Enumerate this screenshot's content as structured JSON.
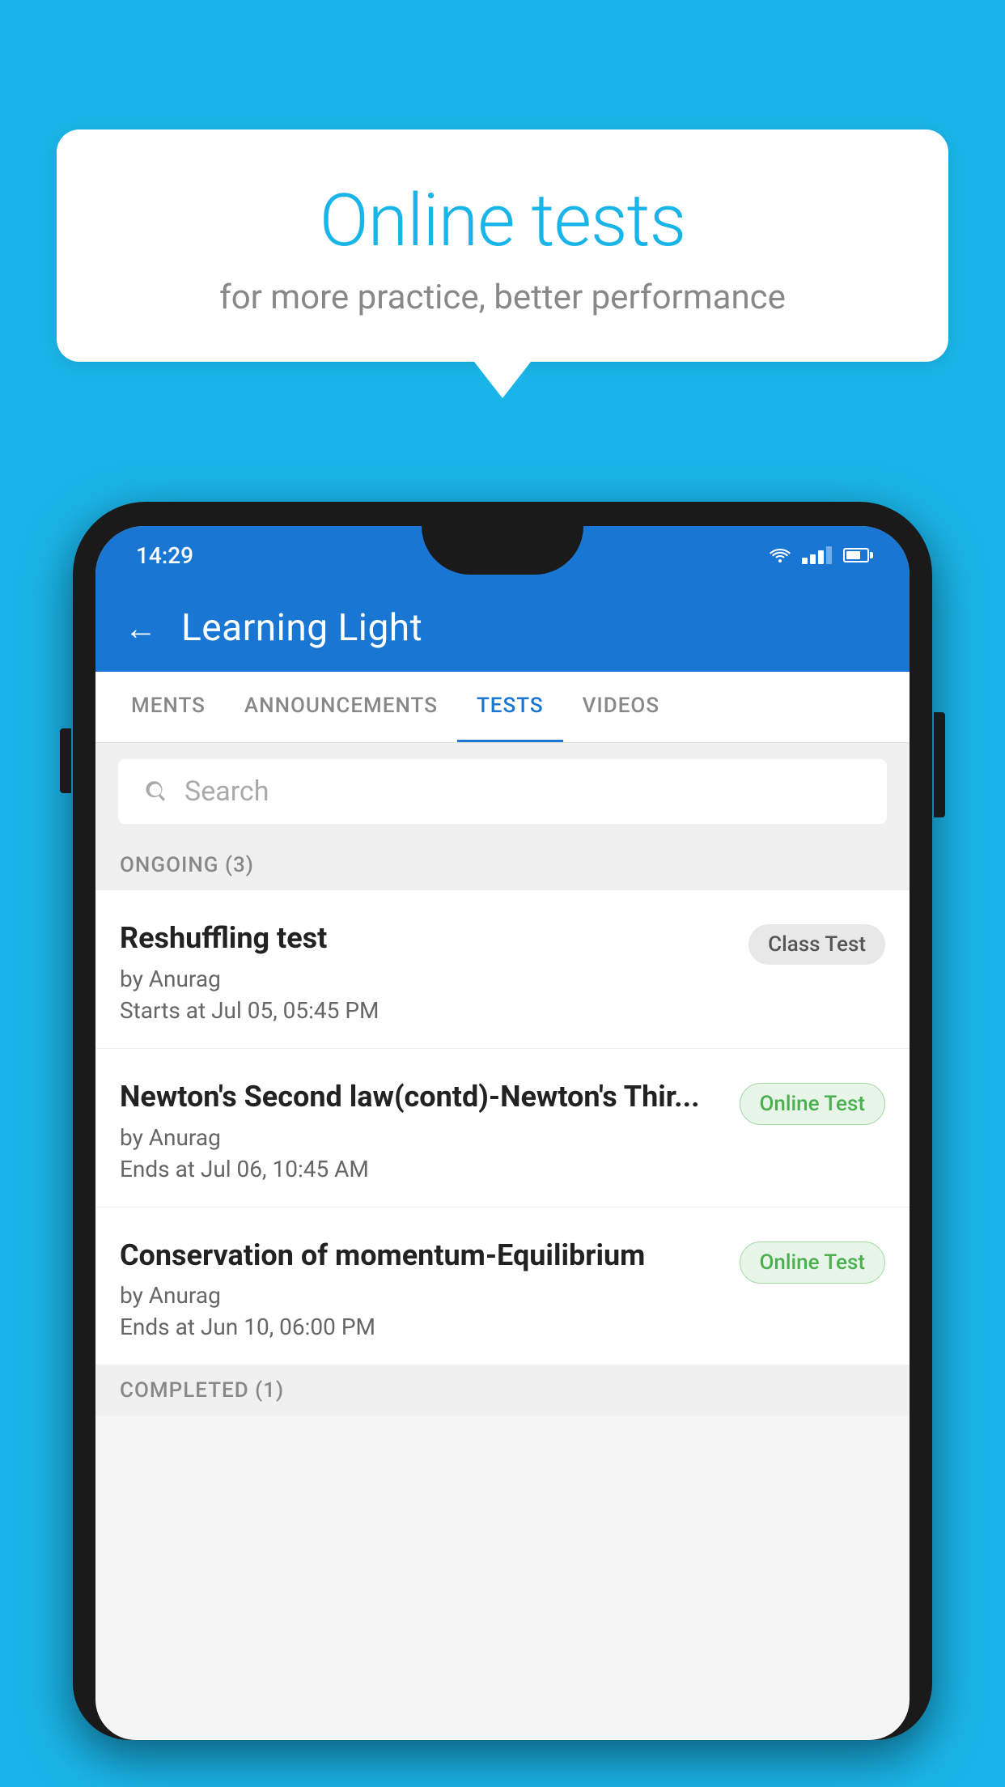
{
  "background_color": "#1ab5e8",
  "bubble": {
    "title": "Online tests",
    "subtitle": "for more practice, better performance"
  },
  "status_bar": {
    "time": "14:29"
  },
  "app_bar": {
    "back_label": "←",
    "title": "Learning Light"
  },
  "tabs": [
    {
      "label": "MENTS",
      "active": false
    },
    {
      "label": "ANNOUNCEMENTS",
      "active": false
    },
    {
      "label": "TESTS",
      "active": true
    },
    {
      "label": "VIDEOS",
      "active": false
    }
  ],
  "search": {
    "placeholder": "Search"
  },
  "ongoing_section": {
    "header": "ONGOING (3)",
    "items": [
      {
        "name": "Reshuffling test",
        "by": "by Anurag",
        "time_label": "Starts at",
        "time": "Jul 05, 05:45 PM",
        "badge": "Class Test",
        "badge_type": "class"
      },
      {
        "name": "Newton's Second law(contd)-Newton's Thir...",
        "by": "by Anurag",
        "time_label": "Ends at",
        "time": "Jul 06, 10:45 AM",
        "badge": "Online Test",
        "badge_type": "online"
      },
      {
        "name": "Conservation of momentum-Equilibrium",
        "by": "by Anurag",
        "time_label": "Ends at",
        "time": "Jun 10, 06:00 PM",
        "badge": "Online Test",
        "badge_type": "online"
      }
    ]
  },
  "completed_section": {
    "header": "COMPLETED (1)"
  }
}
